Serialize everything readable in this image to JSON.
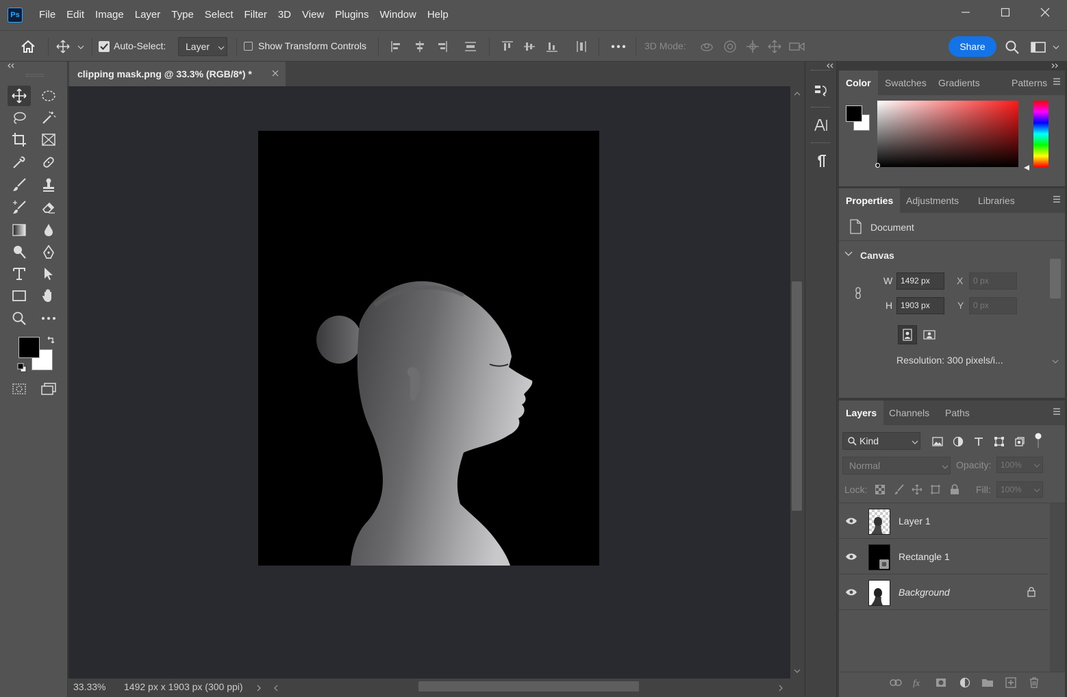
{
  "app": {
    "logo": "Ps"
  },
  "menu": [
    "File",
    "Edit",
    "Image",
    "Layer",
    "Type",
    "Select",
    "Filter",
    "3D",
    "View",
    "Plugins",
    "Window",
    "Help"
  ],
  "options": {
    "auto_select_label": "Auto-Select:",
    "auto_select_value": "Layer",
    "transform_label": "Show Transform Controls",
    "mode_label": "3D Mode:",
    "share_label": "Share"
  },
  "document": {
    "tab_title": "clipping mask.png @ 33.3% (RGB/8*) *",
    "zoom": "33.33%",
    "info": "1492 px x 1903 px (300 ppi)"
  },
  "color_panel": {
    "tabs": [
      "Color",
      "Swatches",
      "Gradients",
      "Patterns"
    ],
    "foreground": "#000000",
    "background": "#ffffff"
  },
  "properties_panel": {
    "tabs": [
      "Properties",
      "Adjustments",
      "Libraries"
    ],
    "doc_label": "Document",
    "section": "Canvas",
    "w_label": "W",
    "w_value": "1492 px",
    "h_label": "H",
    "h_value": "1903 px",
    "x_label": "X",
    "x_value": "0 px",
    "y_label": "Y",
    "y_value": "0 px",
    "resolution": "Resolution: 300 pixels/i..."
  },
  "layers_panel": {
    "tabs": [
      "Layers",
      "Channels",
      "Paths"
    ],
    "filter_kind": "Kind",
    "blend_mode": "Normal",
    "opacity_label": "Opacity:",
    "opacity_value": "100%",
    "lock_label": "Lock:",
    "fill_label": "Fill:",
    "fill_value": "100%",
    "layers": [
      {
        "name": "Layer 1"
      },
      {
        "name": "Rectangle 1"
      },
      {
        "name": "Background"
      }
    ]
  },
  "colors": {
    "accent": "#1473e6",
    "panel": "#535353",
    "canvas_bg": "#282a2f"
  }
}
